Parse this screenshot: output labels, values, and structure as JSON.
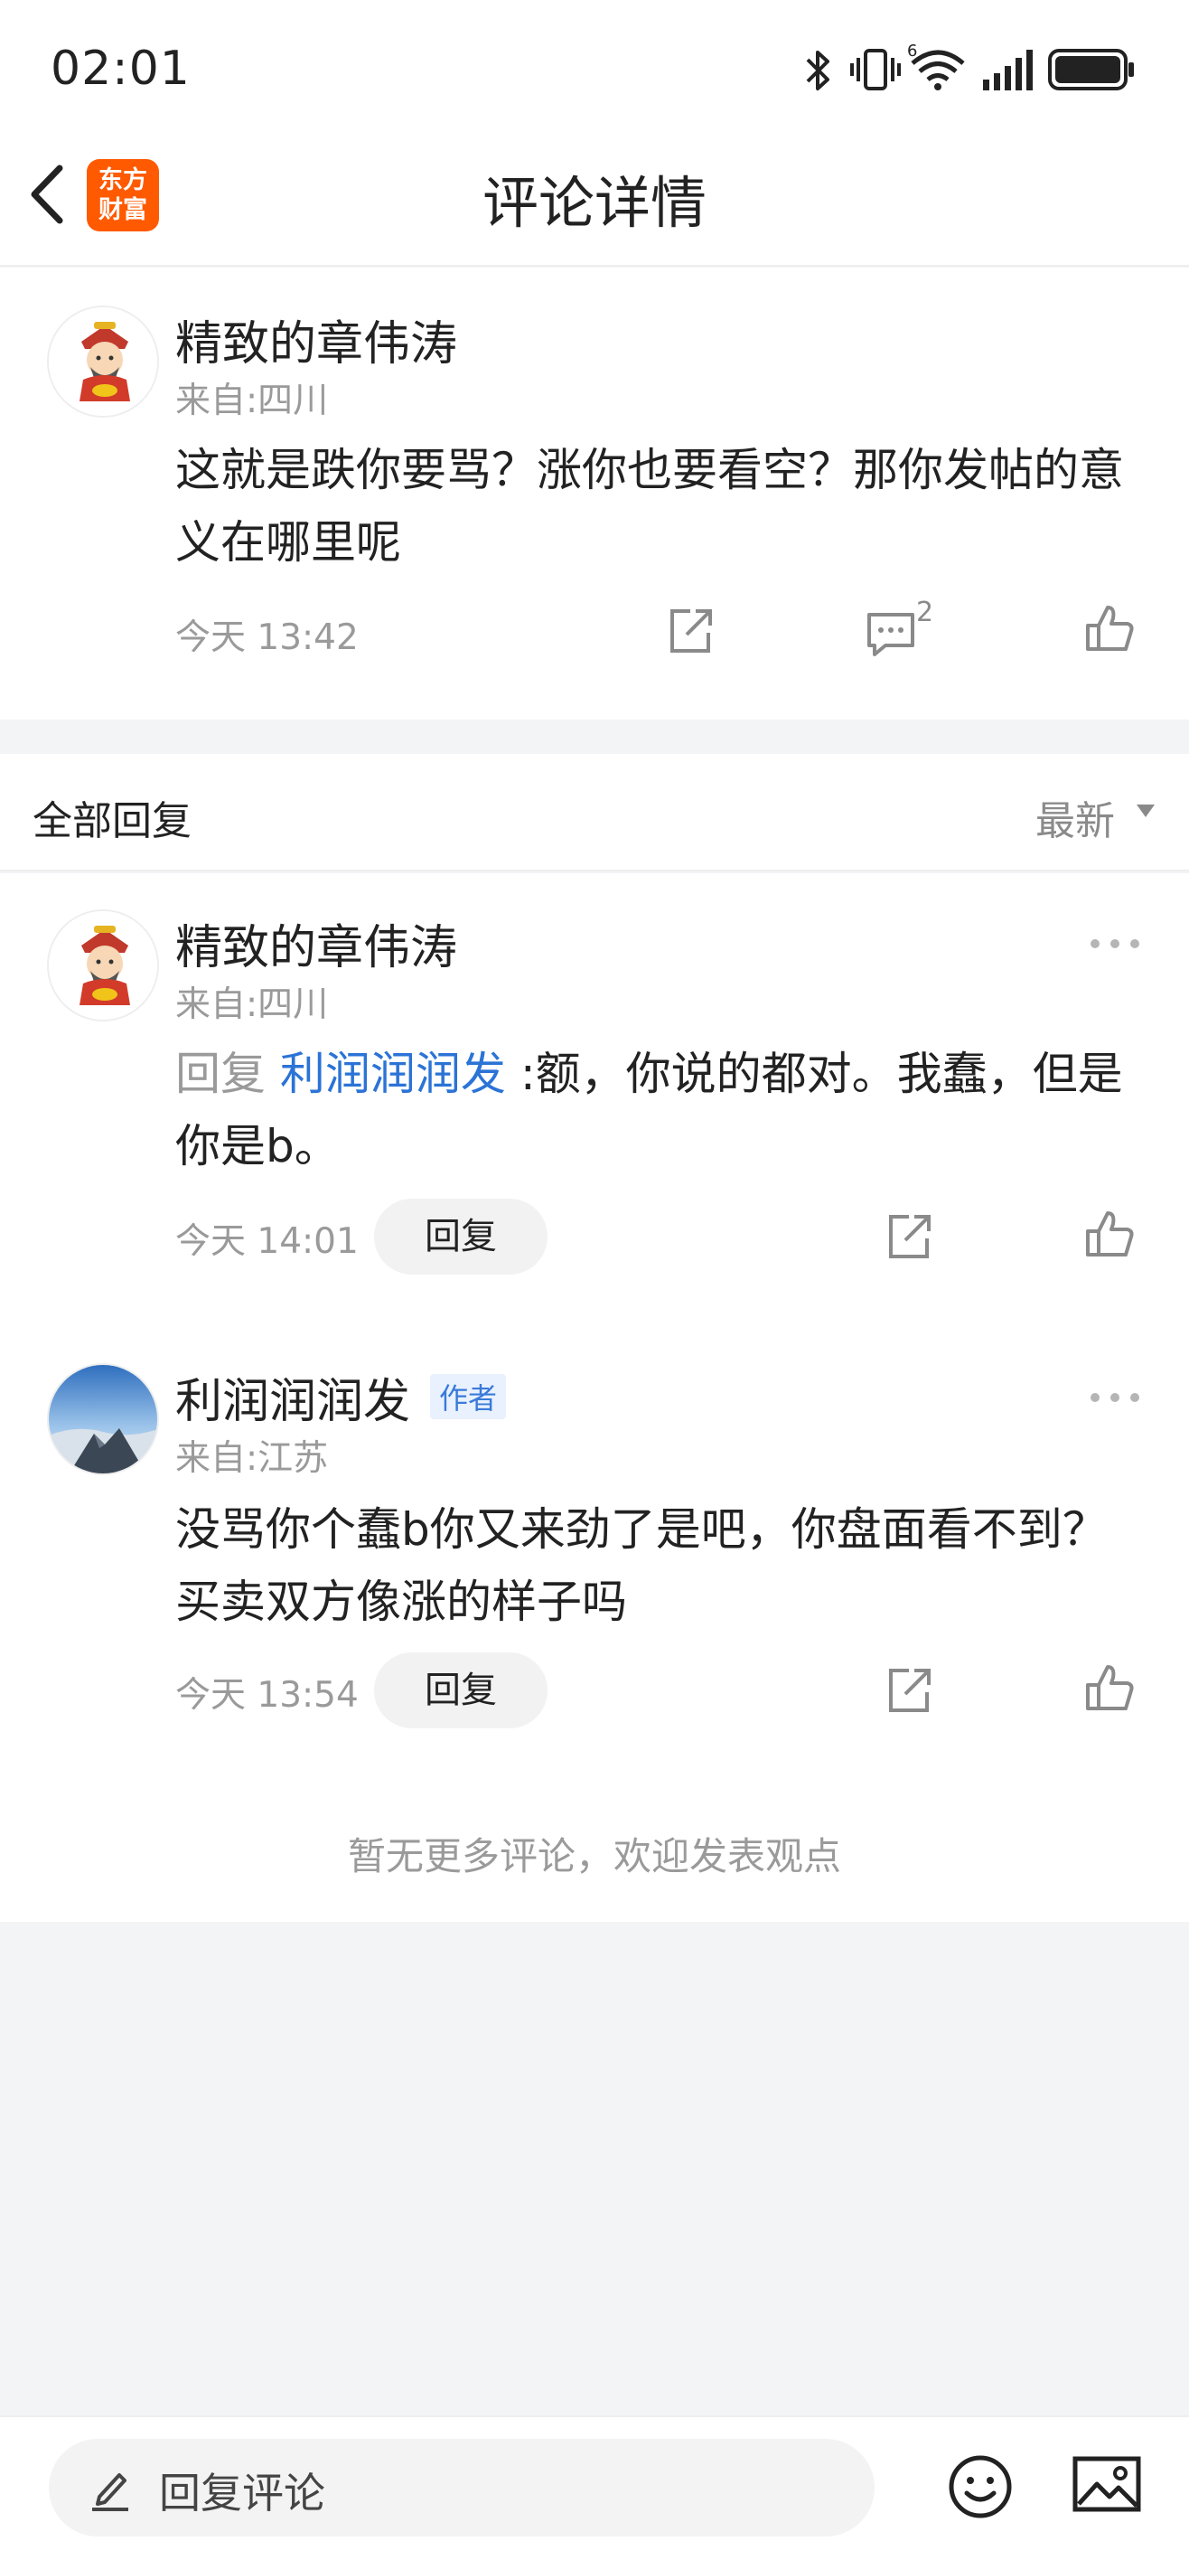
{
  "status_bar": {
    "time": "02:01",
    "icons": [
      "bluetooth-icon",
      "vibrate-icon",
      "wifi-6-icon",
      "signal-icon",
      "battery-icon"
    ],
    "wifi_label": "6"
  },
  "header": {
    "title": "评论详情",
    "logo_line1": "东方",
    "logo_line2": "财富",
    "logo_color": "#ff5a00"
  },
  "main_comment": {
    "username": "精致的章伟涛",
    "location": "来自:四川",
    "text": "这就是跌你要骂？涨你也要看空？那你发帖的意义在哪里呢",
    "time": "今天 13:42",
    "reply_count": "2"
  },
  "replies_section": {
    "title": "全部回复",
    "sort_label": "最新"
  },
  "replies": [
    {
      "username": "精致的章伟涛",
      "location": "来自:四川",
      "reply_prefix": "回复",
      "reply_to": "利润润润发",
      "text": ":额，你说的都对。我蠢，但是你是b。",
      "time": "今天 14:01",
      "reply_button": "回复"
    },
    {
      "username": "利润润润发",
      "badge": "作者",
      "location": "来自:江苏",
      "text": "没骂你个蠢b你又来劲了是吧，你盘面看不到？买卖双方像涨的样子吗",
      "time": "今天 13:54",
      "reply_button": "回复"
    }
  ],
  "footer_note": "暂无更多评论，欢迎发表观点",
  "bottom_bar": {
    "placeholder": "回复评论"
  },
  "colors": {
    "accent_blue": "#2b73d6",
    "secondary_text": "#9a9a9a",
    "background": "#f3f4f6"
  }
}
